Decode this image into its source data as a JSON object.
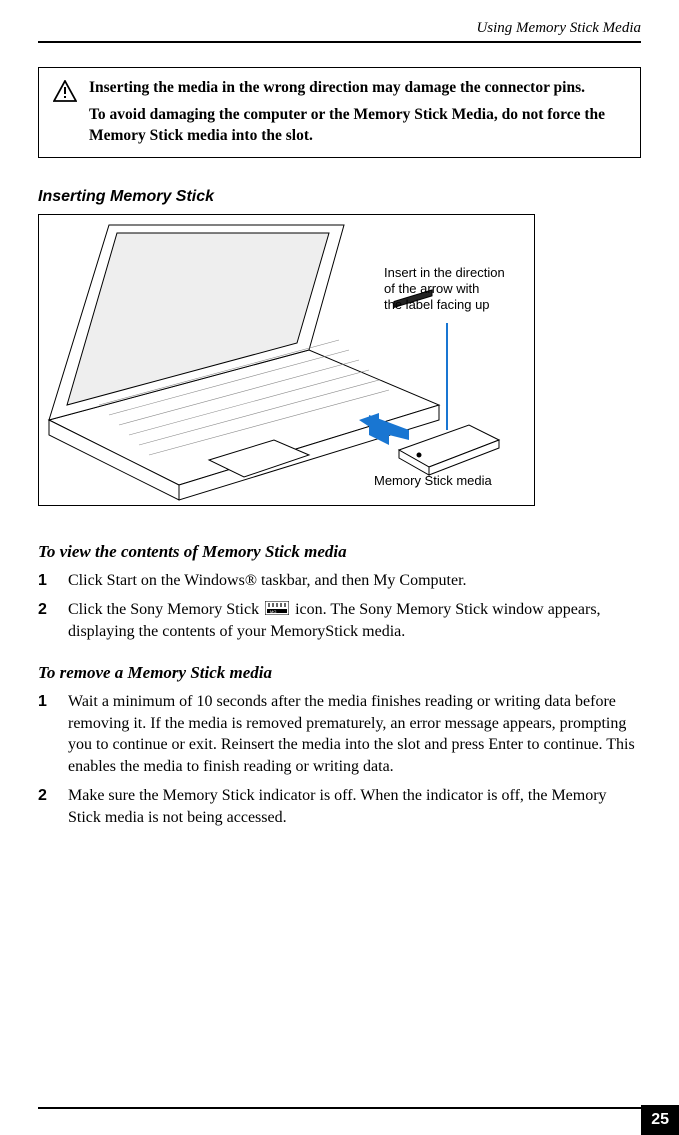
{
  "running_head": "Using Memory Stick Media",
  "caution": {
    "line1": "Inserting the media in the wrong direction may damage the connector pins.",
    "line2": "To avoid damaging the computer or the Memory Stick Media, do not force the Memory Stick media into the slot."
  },
  "figure_title": "Inserting Memory Stick",
  "figure": {
    "annot_main": "Insert in the direction\nof the arrow with\nthe label facing up",
    "annot_media": "Memory Stick media"
  },
  "view_section": {
    "title": "To view the contents of Memory Stick media",
    "steps": [
      "Click Start on the Windows® taskbar, and then My Computer.",
      {
        "pre": "Click the Sony Memory Stick ",
        "post": " icon. The Sony Memory Stick window appears, displaying the contents of your MemoryStick media."
      }
    ]
  },
  "remove_section": {
    "title": "To remove a Memory Stick media",
    "steps": [
      "Wait a minimum of 10 seconds after the media finishes reading or writing data before removing it. If the media is removed prematurely, an error message appears, prompting you to continue or exit. Reinsert the media into the slot and press Enter to continue. This enables the media to finish reading or writing data.",
      "Make sure the Memory Stick indicator is off. When the indicator is off, the Memory Stick media is not being accessed."
    ]
  },
  "page_number": "25"
}
